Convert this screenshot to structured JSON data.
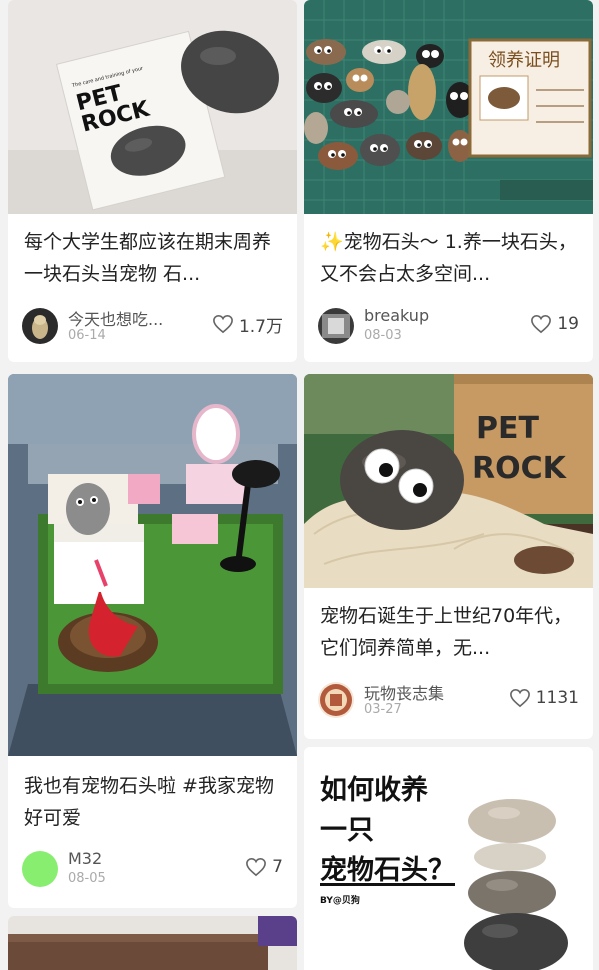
{
  "feed": {
    "cards": [
      {
        "image_text_1": "The care and training of your",
        "image_text_2": "PET",
        "image_text_3": "ROCK",
        "title": "每个大学生都应该在期末周养一块石头当宠物 石...",
        "author": "今天也想吃...",
        "date": "06-14",
        "likes": "1.7万",
        "avatar_icon": "avatar-photo-icon",
        "heart_icon": "heart-outline-icon"
      },
      {
        "title": "我也有宠物石头啦 #我家宠物好可爱",
        "author": "M32",
        "date": "08-05",
        "likes": "7",
        "avatar_color": "#88ee70",
        "heart_icon": "heart-outline-icon"
      },
      {
        "title": "",
        "image_icon": "photo-placeholder-icon"
      },
      {
        "image_text_1": "领养证明",
        "title": "✨宠物石头～ 1.养一块石头，又不会占太多空间...",
        "author": "breakup",
        "date": "08-03",
        "likes": "19",
        "heart_icon": "heart-outline-icon"
      },
      {
        "image_text_1": "PET",
        "image_text_2": "ROCK",
        "title": "宠物石诞生于上世纪70年代，它们饲养简单，无...",
        "author": "玩物丧志集",
        "date": "03-27",
        "likes": "1131",
        "heart_icon": "heart-outline-icon"
      },
      {
        "guide_line_1": "如何收养",
        "guide_line_2": "一只",
        "guide_line_3": "宠物石头？",
        "guide_by": "BY@贝狗"
      }
    ]
  },
  "colors": {
    "background": "#f2f2f2",
    "card": "#ffffff",
    "accent_green": "#88ee70"
  }
}
